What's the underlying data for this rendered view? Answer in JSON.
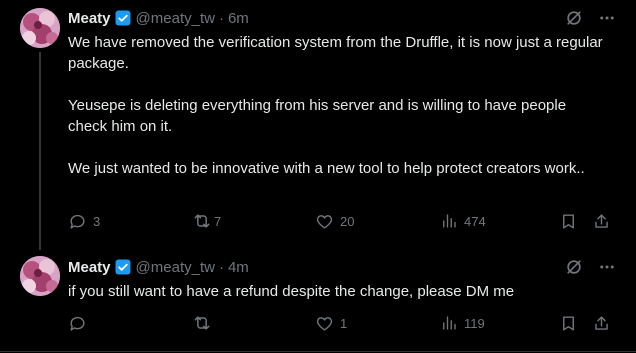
{
  "tweets": [
    {
      "author_name": "Meaty",
      "author_handle": "@meaty_tw",
      "separator": "·",
      "time": "6m",
      "text": "We have removed the verification system from the Druffle, it is now just a regular package.\n\nYeusepe is deleting everything from his server and is willing to have people check him on it.\n\nWe just wanted to be innovative with a new tool to help protect creators work..",
      "replies": "3",
      "retweets": "7",
      "likes": "20",
      "views": "474",
      "icons": [
        "grok-icon",
        "more-icon",
        "reply-icon",
        "retweet-icon",
        "like-icon",
        "views-icon",
        "bookmark-icon",
        "share-icon"
      ]
    },
    {
      "author_name": "Meaty",
      "author_handle": "@meaty_tw",
      "separator": "·",
      "time": "4m",
      "text": "if you still want to have a refund despite the change, please DM me",
      "replies": "",
      "retweets": "",
      "likes": "1",
      "views": "119",
      "icons": [
        "grok-icon",
        "more-icon",
        "reply-icon",
        "retweet-icon",
        "like-icon",
        "views-icon",
        "bookmark-icon",
        "share-icon"
      ]
    }
  ],
  "colors": {
    "background": "#000000",
    "text_primary": "#e7e9ea",
    "text_secondary": "#71767b",
    "verified_badge": "#1d9bf0",
    "divider": "#2f3336"
  }
}
